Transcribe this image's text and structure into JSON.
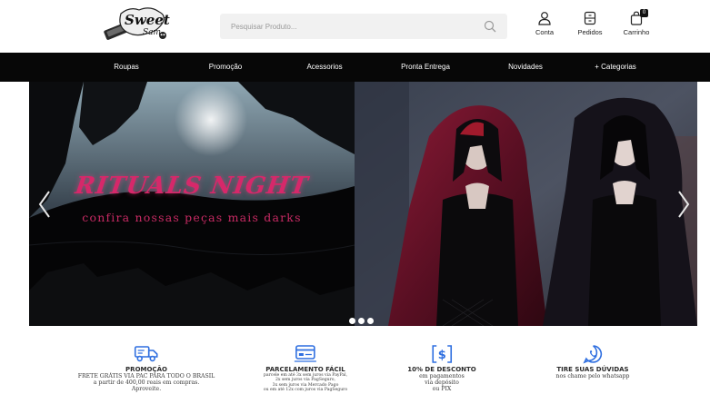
{
  "colors": {
    "accent": "#2f6fe0",
    "nav_bg": "#070707",
    "hero_text": "#d6286a",
    "hero_sub": "#c72a63"
  },
  "header": {
    "logo_icon": "sweet-sam-logo",
    "search": {
      "placeholder": "Pesquisar Produto...",
      "value": ""
    },
    "account_label": "Conta",
    "orders_label": "Pedidos",
    "cart_label": "Carrinho",
    "cart_count": "0"
  },
  "nav": {
    "items": [
      {
        "label": "Roupas"
      },
      {
        "label": "Promoção"
      },
      {
        "label": "Acessorios"
      },
      {
        "label": "Pronta Entrega"
      },
      {
        "label": "Novidades"
      },
      {
        "label": "+ Categorias"
      }
    ]
  },
  "hero": {
    "title": "RITUALS NIGHT",
    "subtitle": "confira nossas peças mais darks",
    "slide_count": 3
  },
  "features": [
    {
      "icon": "truck-icon",
      "title": "PROMOÇÃO",
      "lines": [
        "FRETE GRÁTIS VIA PAC PARA TODO O BRASIL",
        "a partir de 400,00 reais em compras.",
        "Aproveite."
      ]
    },
    {
      "icon": "credit-card-icon",
      "title": "PARCELAMENTO FÁCIL",
      "lines": [
        "parcele em até 3x sem juros via PayPal,",
        "2x sem juros via PagSeguro,",
        "3x sem juros via Mercado Pago",
        "ou em até 12x com juros via PagSeguro"
      ]
    },
    {
      "icon": "discount-icon",
      "title": "10% DE DESCONTO",
      "lines": [
        "em pagamentos",
        "via depósito",
        "ou PIX"
      ]
    },
    {
      "icon": "whatsapp-icon",
      "title": "TIRE SUAS DÚVIDAS",
      "lines": [
        "nos chame pelo whatsapp"
      ]
    }
  ]
}
